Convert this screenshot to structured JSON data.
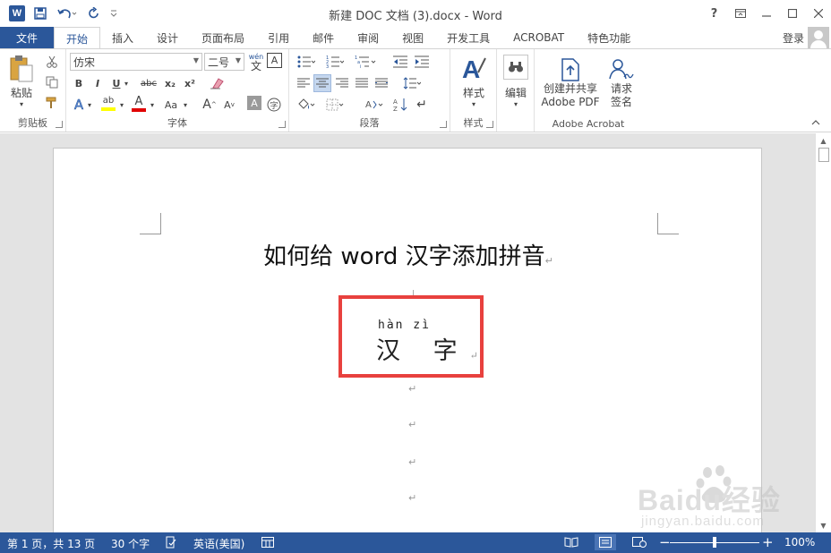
{
  "window": {
    "title": "新建 DOC 文档 (3).docx - Word",
    "controls": {
      "help": "?",
      "restore": "⧉",
      "minimize": "—",
      "maximize": "☐",
      "close": "✕"
    }
  },
  "qat": {
    "app_icon": "W"
  },
  "tabs": {
    "file": "文件",
    "items": [
      "开始",
      "插入",
      "设计",
      "页面布局",
      "引用",
      "邮件",
      "审阅",
      "视图",
      "开发工具",
      "ACROBAT",
      "特色功能"
    ],
    "active_index": 0,
    "login": "登录"
  },
  "ribbon": {
    "clipboard": {
      "paste_label": "粘贴",
      "group_label": "剪贴板"
    },
    "font": {
      "font_name": "仿宋",
      "font_size": "二号",
      "pinyin_icon": "wén",
      "group_label": "字体",
      "bold": "B",
      "italic": "I",
      "underline": "U",
      "strike": "abc",
      "sub": "x₂",
      "sup": "x²",
      "font_a": "A",
      "aa": "Aa",
      "grow": "A",
      "shrink": "A",
      "shade_a": "A"
    },
    "paragraph": {
      "group_label": "段落"
    },
    "styles": {
      "label": "样式",
      "group_label": "样式"
    },
    "editing": {
      "label": "编辑"
    },
    "acrobat": {
      "create_label_1": "创建并共享",
      "create_label_2": "Adobe PDF",
      "sign_label_1": "请求",
      "sign_label_2": "签名",
      "group_label": "Adobe Acrobat"
    }
  },
  "document": {
    "title": "如何给 word 汉字添加拼音",
    "pinyin": "hàn  zì",
    "hanzi": "汉 字",
    "para_mark": "↵"
  },
  "status": {
    "page": "第 1 页，共 13 页",
    "words": "30 个字",
    "language": "英语(美国)",
    "zoom": "100%",
    "zoom_minus": "−",
    "zoom_plus": "+",
    "zoom_fraction": 0.5
  },
  "watermark": {
    "brand": "Baidu经验",
    "url": "jingyan.baidu.com"
  },
  "colors": {
    "accent": "#2b579a",
    "highlight_box": "#e8413e"
  }
}
